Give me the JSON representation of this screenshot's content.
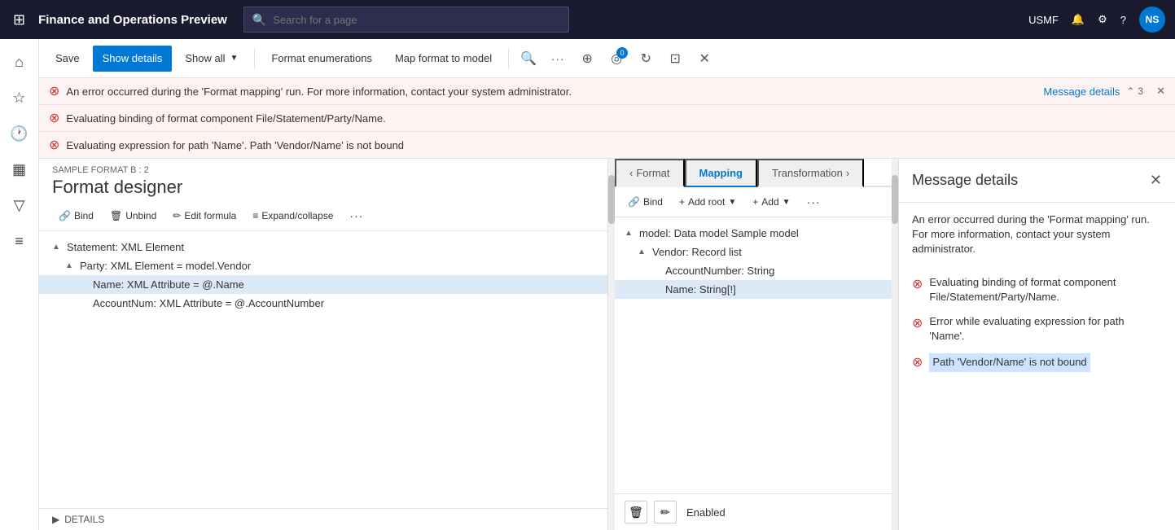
{
  "app": {
    "title": "Finance and Operations Preview",
    "env": "USMF",
    "avatar": "NS"
  },
  "search": {
    "placeholder": "Search for a page"
  },
  "toolbar": {
    "save": "Save",
    "show_details": "Show details",
    "show_all": "Show all",
    "format_enumerations": "Format enumerations",
    "map_format_to_model": "Map format to model"
  },
  "errors": [
    {
      "text": "An error occurred during the 'Format mapping' run. For more information, contact your system administrator.",
      "link": "Message details",
      "count": "3"
    },
    {
      "text": "Evaluating binding of format component File/Statement/Party/Name."
    },
    {
      "text": "Evaluating expression for path 'Name'.  Path 'Vendor/Name' is not bound"
    }
  ],
  "designer": {
    "breadcrumb": "SAMPLE FORMAT B : 2",
    "title": "Format designer",
    "tools": {
      "bind": "Bind",
      "unbind": "Unbind",
      "edit_formula": "Edit formula",
      "expand_collapse": "Expand/collapse"
    },
    "tree": [
      {
        "level": 0,
        "label": "Statement: XML Element",
        "arrow": "▲",
        "has_arrow": true
      },
      {
        "level": 1,
        "label": "Party: XML Element = model.Vendor",
        "arrow": "▲",
        "has_arrow": true
      },
      {
        "level": 2,
        "label": "Name: XML Attribute = @.Name",
        "selected": true
      },
      {
        "level": 2,
        "label": "AccountNum: XML Attribute = @.AccountNumber"
      }
    ],
    "details_label": "DETAILS"
  },
  "mapping": {
    "tabs": [
      {
        "label": "Format",
        "active": false
      },
      {
        "label": "Mapping",
        "active": true
      },
      {
        "label": "Transformation",
        "active": false
      }
    ],
    "tools": {
      "bind": "Bind",
      "add_root": "Add root",
      "add": "Add"
    },
    "tree": [
      {
        "level": 0,
        "label": "model: Data model Sample model",
        "arrow": "▲"
      },
      {
        "level": 1,
        "label": "Vendor: Record list",
        "arrow": "▲"
      },
      {
        "level": 2,
        "label": "AccountNumber: String"
      },
      {
        "level": 2,
        "label": "Name: String[!]",
        "selected": true
      }
    ],
    "bottom": {
      "enabled_label": "Enabled"
    }
  },
  "message_details": {
    "title": "Message details",
    "description": "An error occurred during the 'Format mapping' run. For more information, contact your system administrator.",
    "errors": [
      {
        "text": "Evaluating binding of format component File/Statement/Party/Name."
      },
      {
        "text": "Error while evaluating expression for path 'Name'."
      },
      {
        "text_plain": "",
        "text_highlighted": "Path 'Vendor/Name' is not bound"
      }
    ]
  }
}
